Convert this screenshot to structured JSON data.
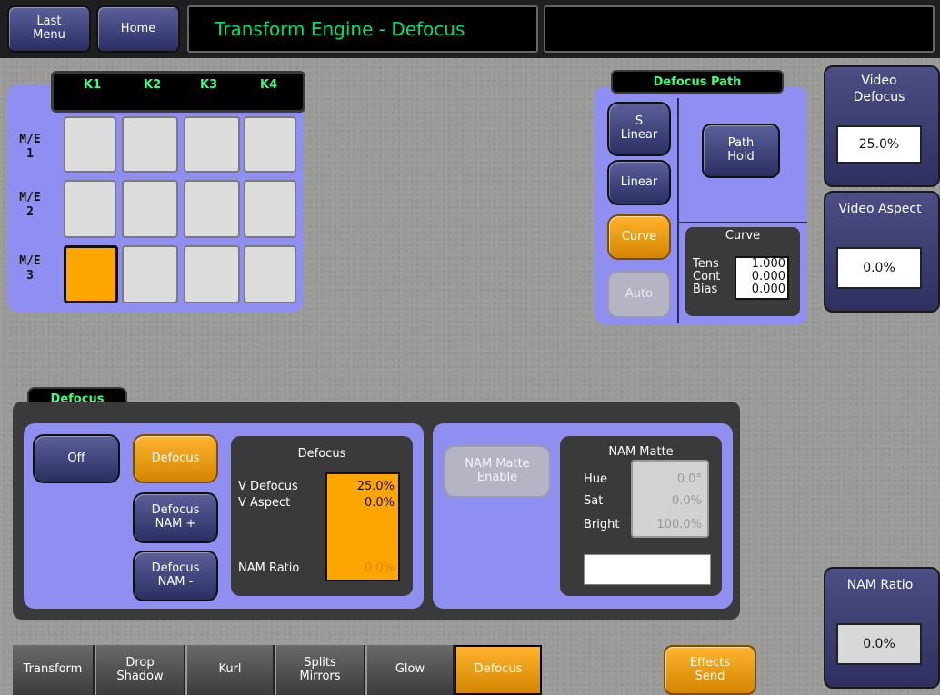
{
  "header": {
    "last_menu": "Last\nMenu",
    "home": "Home",
    "title": "Transform Engine - Defocus",
    "status": ""
  },
  "keyer_grid": {
    "columns": [
      "K1",
      "K2",
      "K3",
      "K4"
    ],
    "rows": [
      "M/E\n1",
      "M/E\n2",
      "M/E\n3"
    ],
    "selected": "M/E 3 K1"
  },
  "defocus_path": {
    "title": "Defocus Path",
    "buttons": [
      "S\nLinear",
      "Linear",
      "Curve",
      "Auto"
    ],
    "active": "Curve",
    "path_hold": "Path\nHold",
    "curve": {
      "title": "Curve",
      "labels": [
        "Tens",
        "Cont",
        "Bias"
      ],
      "tens": "1.000",
      "cont": "0.000",
      "bias": "0.000"
    }
  },
  "side": {
    "video_defocus_label": "Video\nDefocus",
    "video_defocus_value": "25.0%",
    "video_aspect_label": "Video Aspect",
    "video_aspect_value": "0.0%",
    "nam_ratio_label": "NAM Ratio",
    "nam_ratio_value": "0.0%"
  },
  "defocus": {
    "tab": "Defocus",
    "off": "Off",
    "defocus": "Defocus",
    "nam_plus": "Defocus\nNAM +",
    "nam_minus": "Defocus\nNAM -",
    "readout": {
      "title": "Defocus",
      "v_defocus_label": "V Defocus",
      "v_aspect_label": "V Aspect",
      "nam_ratio_label": "NAM Ratio",
      "v_defocus": "25.0%",
      "v_aspect": "0.0%",
      "nam_ratio": "0.0%"
    },
    "nam_matte_enable": "NAM Matte\nEnable",
    "nam_matte": {
      "title": "NAM Matte",
      "hue_label": "Hue",
      "sat_label": "Sat",
      "bright_label": "Bright",
      "hue": "0.0°",
      "sat": "0.0%",
      "bright": "100.0%"
    }
  },
  "bottom_tabs": [
    "Transform",
    "Drop\nShadow",
    "Kurl",
    "Splits\nMirrors",
    "Glow",
    "Defocus"
  ],
  "effects_send": "Effects\nSend",
  "colors": {
    "accent_orange": "#ffa500",
    "panel_purple": "#8f8ff2",
    "title_green": "#00e060"
  }
}
